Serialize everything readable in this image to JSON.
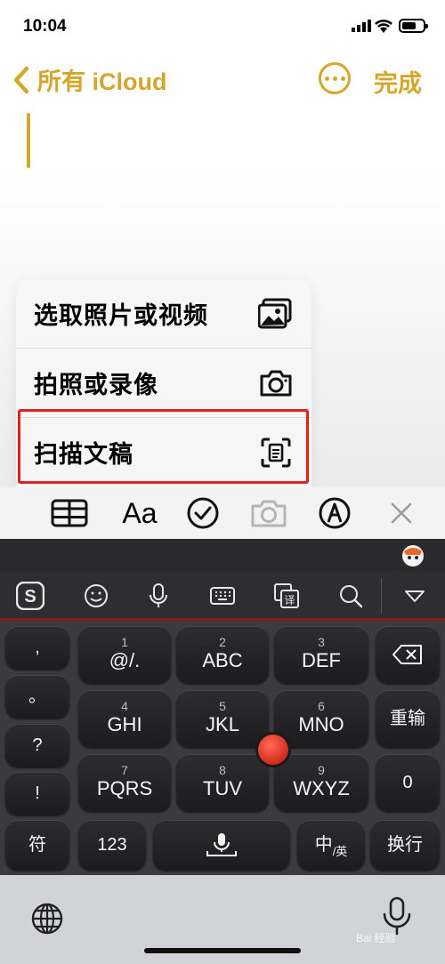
{
  "status": {
    "time": "10:04"
  },
  "nav": {
    "back_label": "所有 iCloud",
    "done_label": "完成"
  },
  "menu": {
    "items": [
      {
        "label": "选取照片或视频",
        "icon": "photo-library-icon"
      },
      {
        "label": "拍照或录像",
        "icon": "camera-icon"
      },
      {
        "label": "扫描文稿",
        "icon": "scan-document-icon"
      }
    ]
  },
  "toolbar": {
    "items": [
      "table-icon",
      "Aa",
      "checklist-icon",
      "camera-icon",
      "markup-icon",
      "close-icon"
    ],
    "format_label": "Aa"
  },
  "keyboard": {
    "tools": [
      "sogou-logo-icon",
      "emoji-icon",
      "microphone-icon",
      "keyboard-icon",
      "translate-icon",
      "search-icon",
      "collapse-icon"
    ],
    "left_keys": [
      ",",
      "。",
      "?",
      "!"
    ],
    "keys": [
      {
        "num": "1",
        "label": "@/."
      },
      {
        "num": "2",
        "label": "ABC"
      },
      {
        "num": "3",
        "label": "DEF"
      },
      {
        "num": "4",
        "label": "GHI"
      },
      {
        "num": "5",
        "label": "JKL"
      },
      {
        "num": "6",
        "label": "MNO"
      },
      {
        "num": "7",
        "label": "PQRS"
      },
      {
        "num": "8",
        "label": "TUV"
      },
      {
        "num": "9",
        "label": "WXYZ"
      }
    ],
    "right_keys": {
      "rewrite": "重输",
      "zero": "0"
    },
    "bottom_keys": {
      "symbol": "符",
      "numbers": "123",
      "lang": "中",
      "lang_sub": "/英",
      "enter": "换行"
    }
  },
  "watermark": "Bai 经验"
}
